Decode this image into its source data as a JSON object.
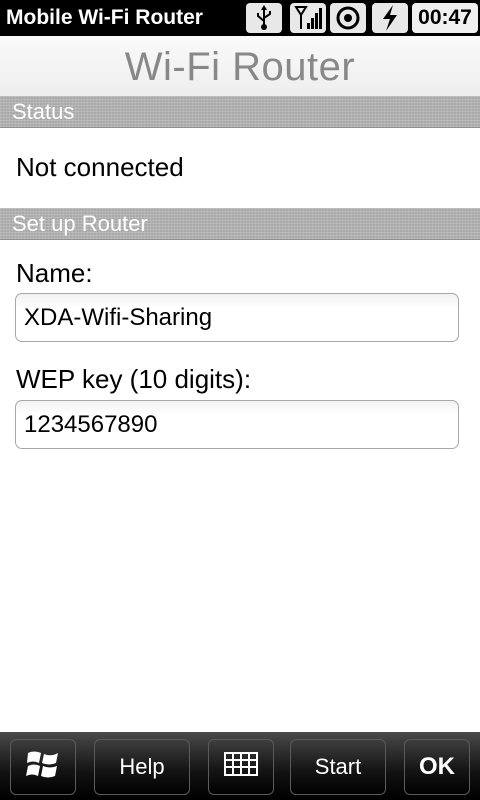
{
  "statusbar": {
    "app_title": "Mobile Wi-Fi Router",
    "time": "00:47",
    "icons": [
      "usb-icon",
      "signal-icon",
      "sync-icon",
      "battery-charging-icon"
    ]
  },
  "header": {
    "title": "Wi-Fi Router"
  },
  "status_section": {
    "label": "Status",
    "value": "Not connected"
  },
  "setup_section": {
    "label": "Set up Router",
    "name_label": "Name:",
    "name_value": "XDA-Wifi-Sharing",
    "wep_label": "WEP key (10 digits):",
    "wep_value": "1234567890"
  },
  "softkeys": {
    "help": "Help",
    "start": "Start",
    "ok": "OK",
    "icons": [
      "windows-start-icon",
      "keyboard-icon"
    ]
  }
}
